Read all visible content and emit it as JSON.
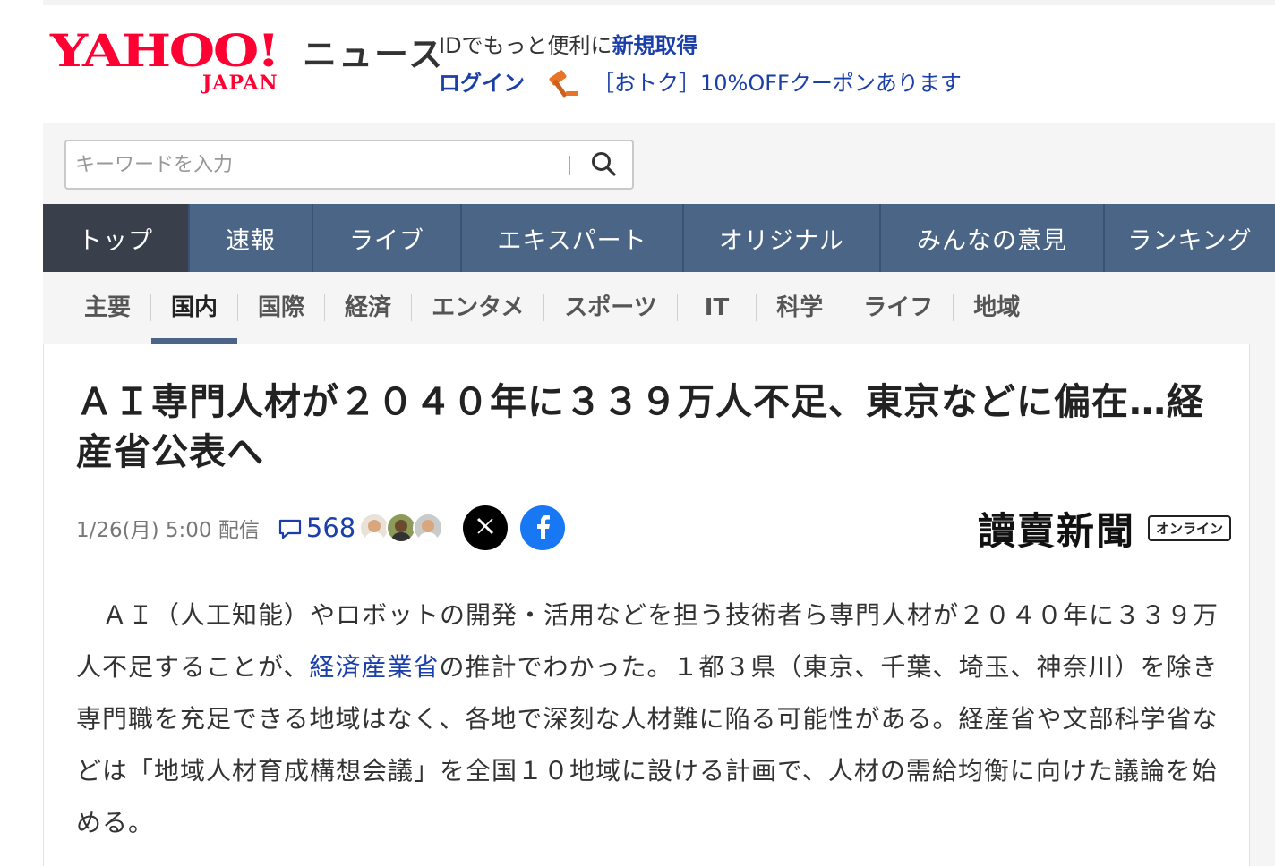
{
  "header": {
    "logo_main": "YAHOO!",
    "logo_sub": "JAPAN",
    "section_name": "ニュース",
    "id_prompt": "IDでもっと便利に",
    "register_link": "新規取得",
    "login_link": "ログイン",
    "coupon_text": "［おトク］10%OFFクーポンあります"
  },
  "search": {
    "placeholder": "キーワードを入力"
  },
  "main_nav": [
    "トップ",
    "速報",
    "ライブ",
    "エキスパート",
    "オリジナル",
    "みんなの意見",
    "ランキング"
  ],
  "sub_nav": [
    "主要",
    "国内",
    "国際",
    "経済",
    "エンタメ",
    "スポーツ",
    "IT",
    "科学",
    "ライフ",
    "地域"
  ],
  "article": {
    "headline": "ＡＩ専門人材が２０４０年に３３９万人不足、東京などに偏在…経産省公表へ",
    "date": "1/26(月) 5:00 配信",
    "comment_count": "568",
    "publisher_name": "讀賣新聞",
    "publisher_badge": "オンライン",
    "body_before_link": "　ＡＩ（人工知能）やロボットの開発・活用などを担う技術者ら専門人材が２０４０年に３３９万人不足することが、",
    "body_link": "経済産業省",
    "body_after_link": "の推計でわかった。１都３県（東京、千葉、埼玉、神奈川）を除き専門職を充足できる地域はなく、各地で深刻な人材難に陥る可能性がある。経産省や文部科学省などは「地域人材育成構想会議」を全国１０地域に設ける計画で、人材の需給均衡に向けた議論を始める。"
  },
  "colors": {
    "yahoo_red": "#ff0033",
    "link_blue": "#1a3fa8",
    "nav_blue": "#4a6585",
    "nav_active": "#3a3f4c",
    "facebook_blue": "#1877f2"
  }
}
